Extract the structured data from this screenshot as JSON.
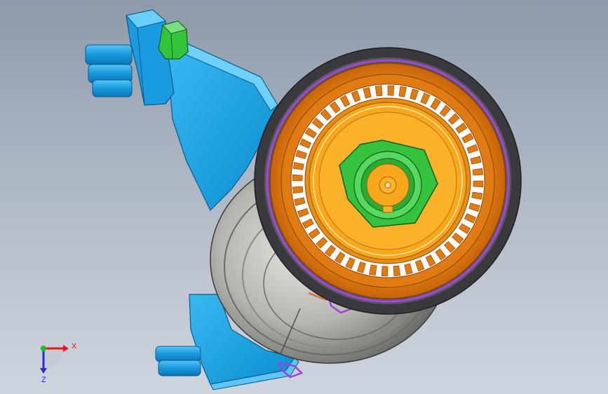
{
  "viewport": {
    "background_top": "#8e9aab",
    "background_bottom": "#cfd5de"
  },
  "model": {
    "parts": [
      {
        "name": "mounting-bracket",
        "color": "#12a4e8"
      },
      {
        "name": "bolt-sleeve-upper",
        "color": "#19a0e6"
      },
      {
        "name": "bolt-sleeve-lower",
        "color": "#19a0e6"
      },
      {
        "name": "hex-bolt-top",
        "color": "#2fbf3a"
      },
      {
        "name": "tensioner-housing",
        "color": "#a8a8a4"
      },
      {
        "name": "pulley-rim",
        "color": "#3d3d40"
      },
      {
        "name": "pulley-ring",
        "color": "#e8840e"
      },
      {
        "name": "pulley-hub",
        "color": "#f8a81c"
      },
      {
        "name": "center-hex-nut",
        "color": "#33c23e"
      },
      {
        "name": "spring-clip",
        "color": "#a040e0"
      }
    ],
    "tooth_count": 48
  },
  "triad": {
    "x_label": "X",
    "z_label": "Z",
    "x_color": "#e01818",
    "y_color": "#1fb82a",
    "z_color": "#2a2ad8"
  }
}
